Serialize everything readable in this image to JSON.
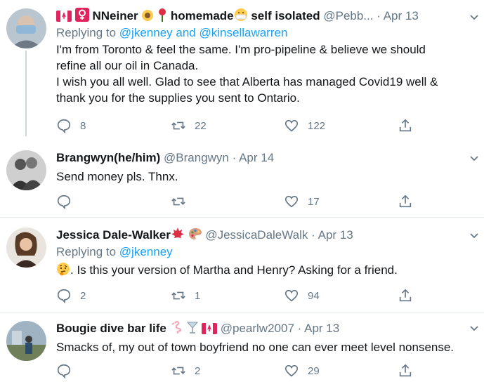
{
  "tweets": [
    {
      "name": "NNeiner",
      "name_suffix": "homemade",
      "name_tail": "self isolated",
      "handle": "@Pebb...",
      "date": "Apr 13",
      "replying_prefix": "Replying to",
      "replying_mention_1": "@jkenney",
      "replying_and": "and",
      "replying_mention_2": "@kinsellawarren",
      "text_lines": [
        "I'm from Toronto & feel the same. I'm pro-pipeline & believe we should",
        "refine all our oil in Canada.",
        "I wish you all well.  Glad to see that Alberta has managed Covid19 well &",
        "thank you for the supplies you sent to Ontario."
      ],
      "replies": "8",
      "retweets": "22",
      "likes": "122"
    },
    {
      "name": "Brangwyn(he/him)",
      "handle": "@Brangwyn",
      "date": "Apr 14",
      "text": "Send money pls. Thnx.",
      "replies": "",
      "retweets": "",
      "likes": "17"
    },
    {
      "name": "Jessica Dale-Walker",
      "handle": "@JessicaDaleWalk",
      "date": "Apr 13",
      "replying_prefix": "Replying to",
      "replying_mention_1": "@jkenney",
      "text": ".  Is this your version of Martha and Henry? Asking for a friend.",
      "replies": "2",
      "retweets": "1",
      "likes": "94"
    },
    {
      "name": "Bougie dive bar life",
      "handle": "@pearlw2007",
      "date": "Apr 13",
      "text": "Smacks of, my out of town boyfriend no one can ever meet level nonsense.",
      "replies": "",
      "retweets": "2",
      "likes": "29"
    }
  ],
  "separator": "·",
  "colors": {
    "accent": "#1da1f2",
    "muted": "#657786",
    "divider": "#e6ecf0",
    "canada_red": "#e0245e"
  }
}
